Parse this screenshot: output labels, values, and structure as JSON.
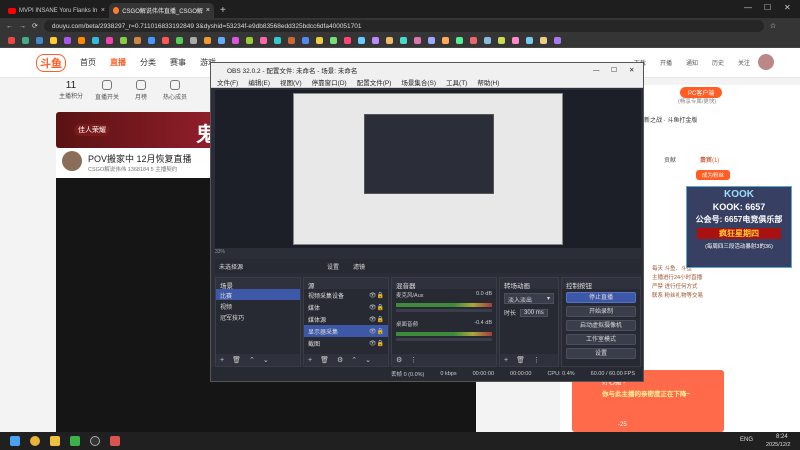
{
  "browser": {
    "tabs": [
      {
        "label": "MVPI INSANE Yoru Flanks In",
        "icon": "youtube-icon",
        "active": false
      },
      {
        "label": "CSGO解说伟伟直播_CSGO解",
        "icon": "douyu-icon",
        "active": true
      }
    ],
    "new_tab": "+",
    "url": "douyu.com/beta/2938297_r=0.711016833192849 3&dyshid=53234f-e9db83568edd325bdcc6dfa400051701",
    "window_controls": [
      "—",
      "☐",
      "✕"
    ]
  },
  "site": {
    "logo": "斗鱼",
    "nav": [
      "首页",
      "直播",
      "分类",
      "赛事",
      "游戏"
    ],
    "active_nav": "直播",
    "top_icons": [
      {
        "count": "11",
        "label": "主播积分"
      },
      {
        "count": "",
        "label": "直播开关"
      },
      {
        "count": "",
        "label": "月榜"
      },
      {
        "count": "",
        "label": "热心成员"
      },
      {
        "count": "",
        "label": "观..."
      }
    ],
    "search_placeholder": "",
    "right_nav": [
      "下载",
      "开播",
      "通知",
      "历史",
      "关注"
    ],
    "banner_text": "鬼服",
    "banner_tag": "佳人荣耀",
    "streamer": {
      "title": "POV搬家中 12月恢复直播",
      "sub": "CSGO解说伟伟  1368184  5 主播契约"
    },
    "right_panel": {
      "pc_client": "PC客户端",
      "pc_client_sub": "(畅享专属/更快)",
      "notice_title": "新之战 · 斗鱼打金版",
      "rank_label": "贡献",
      "rank_label2": "贵宾",
      "fans": "粉丝(1)",
      "become_fan": "成为粉丝",
      "notice_lines": [
        "每天 斗鱼、斗鱼",
        "主播进行24小时直播",
        "严禁 进行任何方式",
        "联系 粉丝礼物等交易"
      ]
    },
    "overlay": {
      "brand": "KOOK",
      "line1": "KOOK: 6657",
      "line2": "公会号: 6657电竞俱乐部",
      "line3": "疯狂星期四",
      "line4": "(每周四三段活动暴射3的36)"
    },
    "popup": {
      "title": "好心搬~",
      "text": "你与此主播的亲密度正在下降~",
      "badge": "-25"
    }
  },
  "obs": {
    "title": "OBS 32.0.2 - 配置文件: 未命名 - 场景: 未命名",
    "menu": [
      "文件(F)",
      "编辑(E)",
      "视图(V)",
      "停靠窗口(D)",
      "配置文件(P)",
      "场景集合(S)",
      "工具(T)",
      "帮助(H)"
    ],
    "source_bar": {
      "selected": "未选择源",
      "settings": "设置",
      "filters": "滤镜"
    },
    "docks": {
      "scenes": {
        "title": "场景",
        "items": [
          "比赛",
          "视频",
          "冠军技巧"
        ],
        "selected": 0
      },
      "sources": {
        "title": "源",
        "items": [
          {
            "label": "视频采集设备"
          },
          {
            "label": "媒体"
          },
          {
            "label": "媒体源"
          },
          {
            "label": "显示器采集"
          },
          {
            "label": "截图"
          }
        ],
        "selected": 3
      },
      "mixer": {
        "title": "混音器",
        "tracks": [
          {
            "name": "麦克风/Aux",
            "db": "0.0 dB"
          },
          {
            "name": "桌面音频",
            "db": "-0.4 dB"
          }
        ]
      },
      "transitions": {
        "title": "转场动画",
        "type": "淡入淡出",
        "duration_label": "时长",
        "duration": "300 ms"
      },
      "controls": {
        "title": "控制按钮",
        "buttons": [
          "停止直播",
          "开始录制",
          "启动虚拟摄像机",
          "工作室模式",
          "设置"
        ]
      }
    },
    "status": {
      "dropped": "丢帧 0 (0.0%)",
      "kbps": "0 kbps",
      "stream_time": "00:00:00",
      "rec_time": "00:00:00",
      "cpu": "CPU: 0.4%",
      "fps": "60.00 / 60.00 FPS"
    },
    "scale_label": "33%"
  },
  "taskbar": {
    "time": "8:24",
    "date": "2025/12/2",
    "lang": "ENG"
  }
}
